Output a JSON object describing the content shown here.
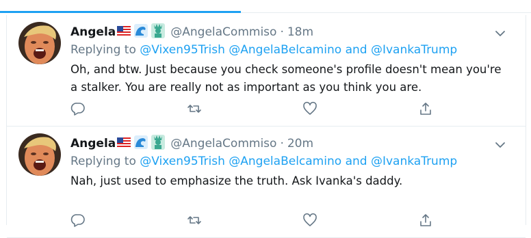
{
  "colors": {
    "accent": "#1da1f2",
    "muted": "#657786",
    "text": "#14171a",
    "border": "#e6ecf0"
  },
  "tweets": [
    {
      "display_name": "Angela",
      "badges": [
        "us-flag-icon",
        "wave-icon",
        "statue-of-liberty-icon"
      ],
      "handle": "@AngelaCommiso",
      "separator": "·",
      "time": "18m",
      "replying_prefix": "Replying to",
      "mention_1": "@Vixen95Trish",
      "mention_2": "@AngelaBelcamino",
      "and_word": "and",
      "mention_3": "@IvankaTrump",
      "text": "Oh, and btw. Just because you check someone's profile doesn't mean you're a stalker. You are really not as important as you think you are."
    },
    {
      "display_name": "Angela",
      "badges": [
        "us-flag-icon",
        "wave-icon",
        "statue-of-liberty-icon"
      ],
      "handle": "@AngelaCommiso",
      "separator": "·",
      "time": "20m",
      "replying_prefix": "Replying to",
      "mention_1": "@Vixen95Trish",
      "mention_2": "@AngelaBelcamino",
      "and_word": "and",
      "mention_3": "@IvankaTrump",
      "text": "Nah, just used to emphasize the truth. Ask Ivanka's daddy."
    }
  ]
}
